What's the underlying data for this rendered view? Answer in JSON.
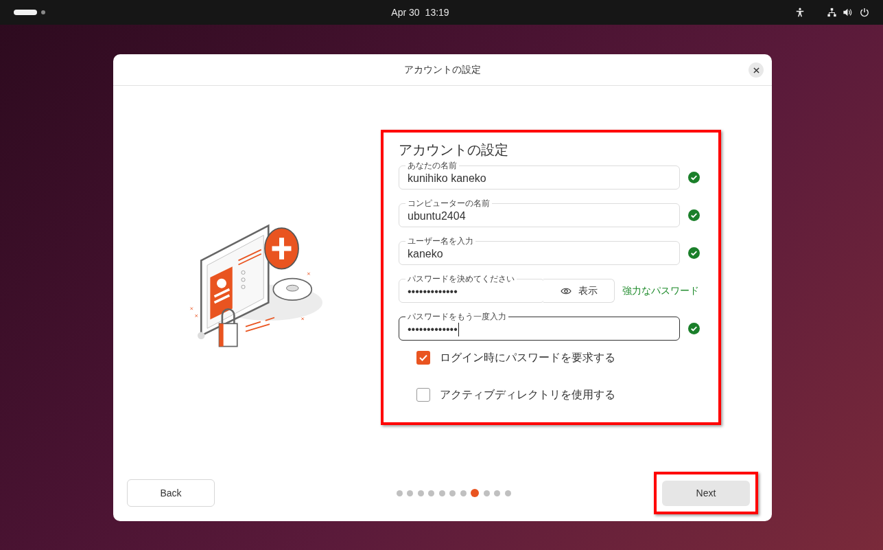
{
  "top_bar": {
    "date": "Apr 30",
    "time": "13:19",
    "workspaces": [
      {
        "selected": true
      },
      {
        "selected": false
      }
    ]
  },
  "dialog": {
    "title": "アカウントの設定",
    "form": {
      "heading": "アカウントの設定",
      "highlighted": true,
      "fields": [
        {
          "kind": "text",
          "label": "あなたの名前",
          "value": "kunihiko kaneko",
          "valid": true,
          "focused": false
        },
        {
          "kind": "text",
          "label": "コンピューターの名前",
          "value": "ubuntu2404",
          "valid": true,
          "focused": false
        },
        {
          "kind": "text",
          "label": "ユーザー名を入力",
          "value": "kaneko",
          "valid": true,
          "focused": false
        },
        {
          "kind": "password",
          "label": "パスワードを決めてください",
          "value": "•••••••••••••",
          "focused": false,
          "show_button": "表示",
          "strength": "強力なパスワード"
        },
        {
          "kind": "text",
          "label": "パスワードをもう一度入力",
          "value": "•••••••••••••",
          "valid": true,
          "focused": true
        }
      ],
      "checkboxes": [
        {
          "label": "ログイン時にパスワードを要求する",
          "checked": true
        },
        {
          "label": "アクティブディレクトリを使用する",
          "checked": false
        }
      ]
    },
    "back_button": "Back",
    "next_button": {
      "label": "Next",
      "highlighted": true
    },
    "steps": [
      {
        "selected": false
      },
      {
        "selected": false
      },
      {
        "selected": false
      },
      {
        "selected": false
      },
      {
        "selected": false
      },
      {
        "selected": false
      },
      {
        "selected": false
      },
      {
        "selected": true
      },
      {
        "selected": false
      },
      {
        "selected": false
      },
      {
        "selected": false
      }
    ]
  }
}
